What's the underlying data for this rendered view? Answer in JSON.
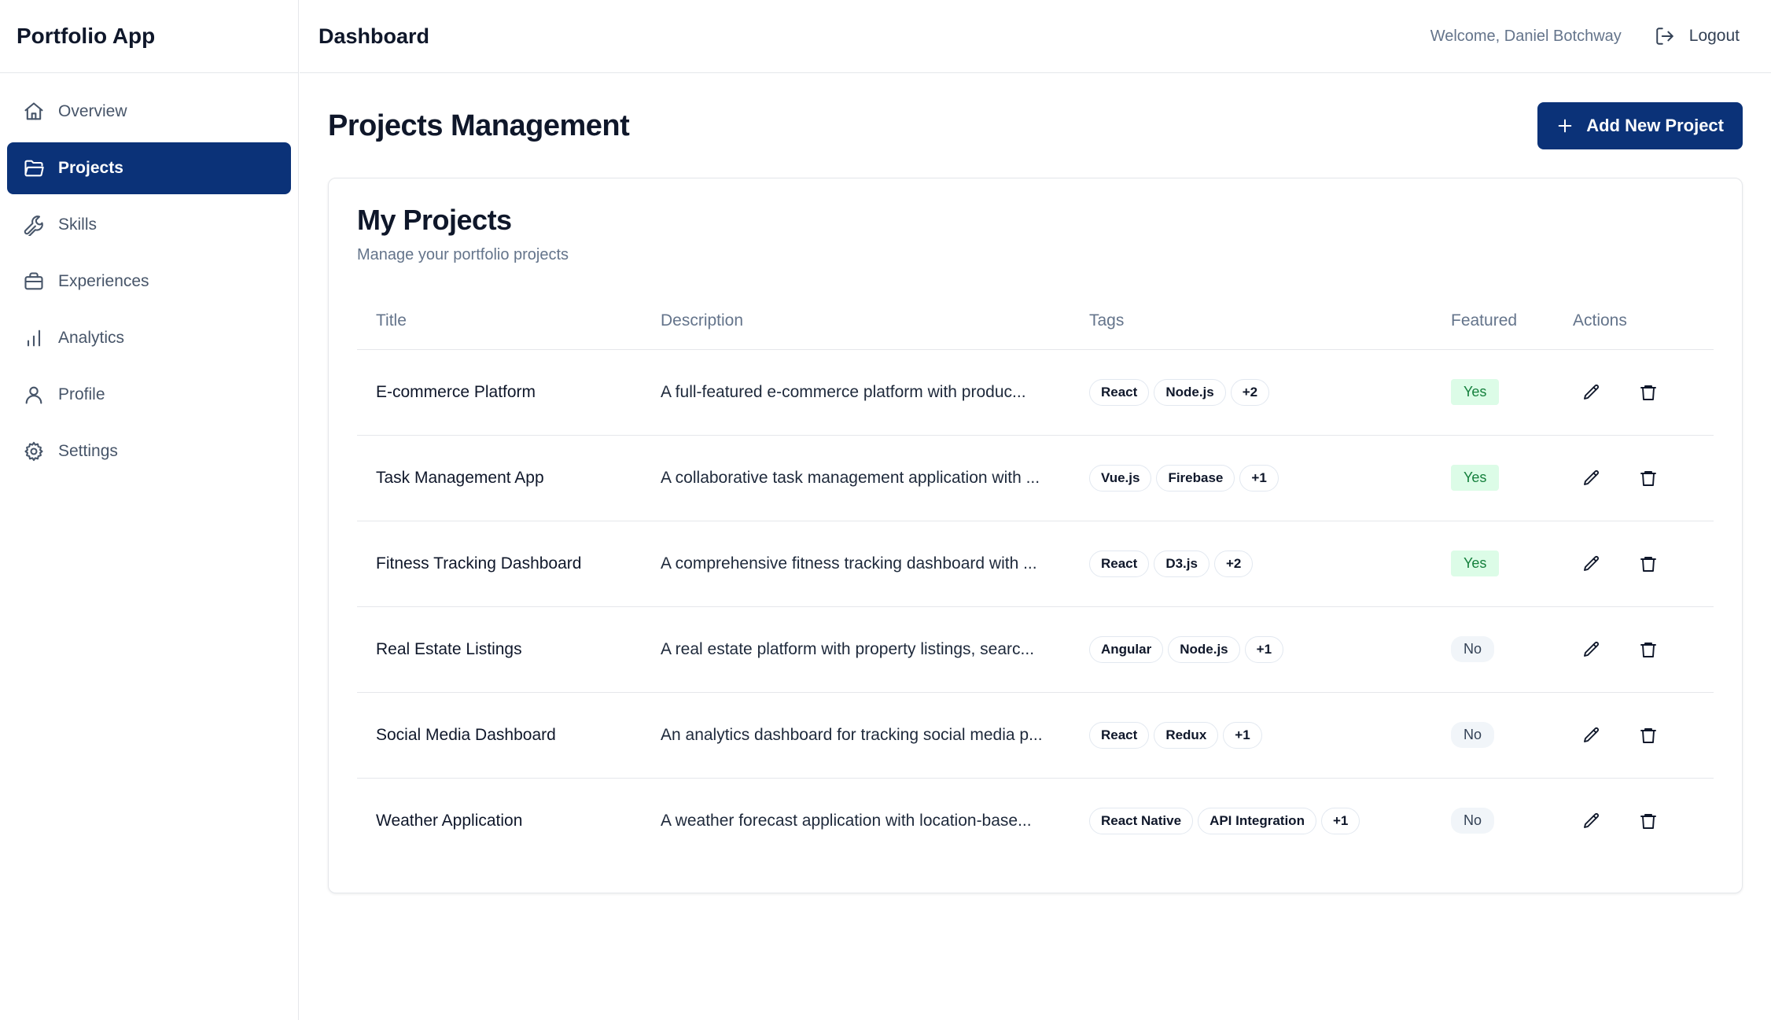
{
  "app": {
    "name": "Portfolio App"
  },
  "header": {
    "title": "Dashboard",
    "welcome": "Welcome, Daniel Botchway",
    "logout_label": "Logout"
  },
  "sidebar": {
    "items": [
      {
        "label": "Overview",
        "icon": "home-icon",
        "active": false
      },
      {
        "label": "Projects",
        "icon": "folder-icon",
        "active": true
      },
      {
        "label": "Skills",
        "icon": "wrench-icon",
        "active": false
      },
      {
        "label": "Experiences",
        "icon": "briefcase-icon",
        "active": false
      },
      {
        "label": "Analytics",
        "icon": "bar-chart-icon",
        "active": false
      },
      {
        "label": "Profile",
        "icon": "user-icon",
        "active": false
      },
      {
        "label": "Settings",
        "icon": "gear-icon",
        "active": false
      }
    ]
  },
  "main": {
    "title": "Projects Management",
    "add_button_label": "Add New Project"
  },
  "card": {
    "title": "My Projects",
    "subtitle": "Manage your portfolio projects"
  },
  "table": {
    "headers": {
      "title": "Title",
      "description": "Description",
      "tags": "Tags",
      "featured": "Featured",
      "actions": "Actions"
    },
    "rows": [
      {
        "title": "E-commerce Platform",
        "description": "A full-featured e-commerce platform with produc...",
        "tags": [
          "React",
          "Node.js"
        ],
        "more": "+2",
        "featured": "Yes"
      },
      {
        "title": "Task Management App",
        "description": "A collaborative task management application with ...",
        "tags": [
          "Vue.js",
          "Firebase"
        ],
        "more": "+1",
        "featured": "Yes"
      },
      {
        "title": "Fitness Tracking Dashboard",
        "description": "A comprehensive fitness tracking dashboard with ...",
        "tags": [
          "React",
          "D3.js"
        ],
        "more": "+2",
        "featured": "Yes"
      },
      {
        "title": "Real Estate Listings",
        "description": "A real estate platform with property listings, searc...",
        "tags": [
          "Angular",
          "Node.js"
        ],
        "more": "+1",
        "featured": "No"
      },
      {
        "title": "Social Media Dashboard",
        "description": "An analytics dashboard for tracking social media p...",
        "tags": [
          "React",
          "Redux"
        ],
        "more": "+1",
        "featured": "No"
      },
      {
        "title": "Weather Application",
        "description": "A weather forecast application with location-base...",
        "tags": [
          "React Native",
          "API Integration"
        ],
        "more": "+1",
        "featured": "No"
      }
    ]
  },
  "colors": {
    "primary": "#0b3278",
    "featured_yes_bg": "#dcfce7",
    "featured_yes_text": "#15803d",
    "muted_text": "#64748b",
    "border": "#e5e7eb"
  }
}
